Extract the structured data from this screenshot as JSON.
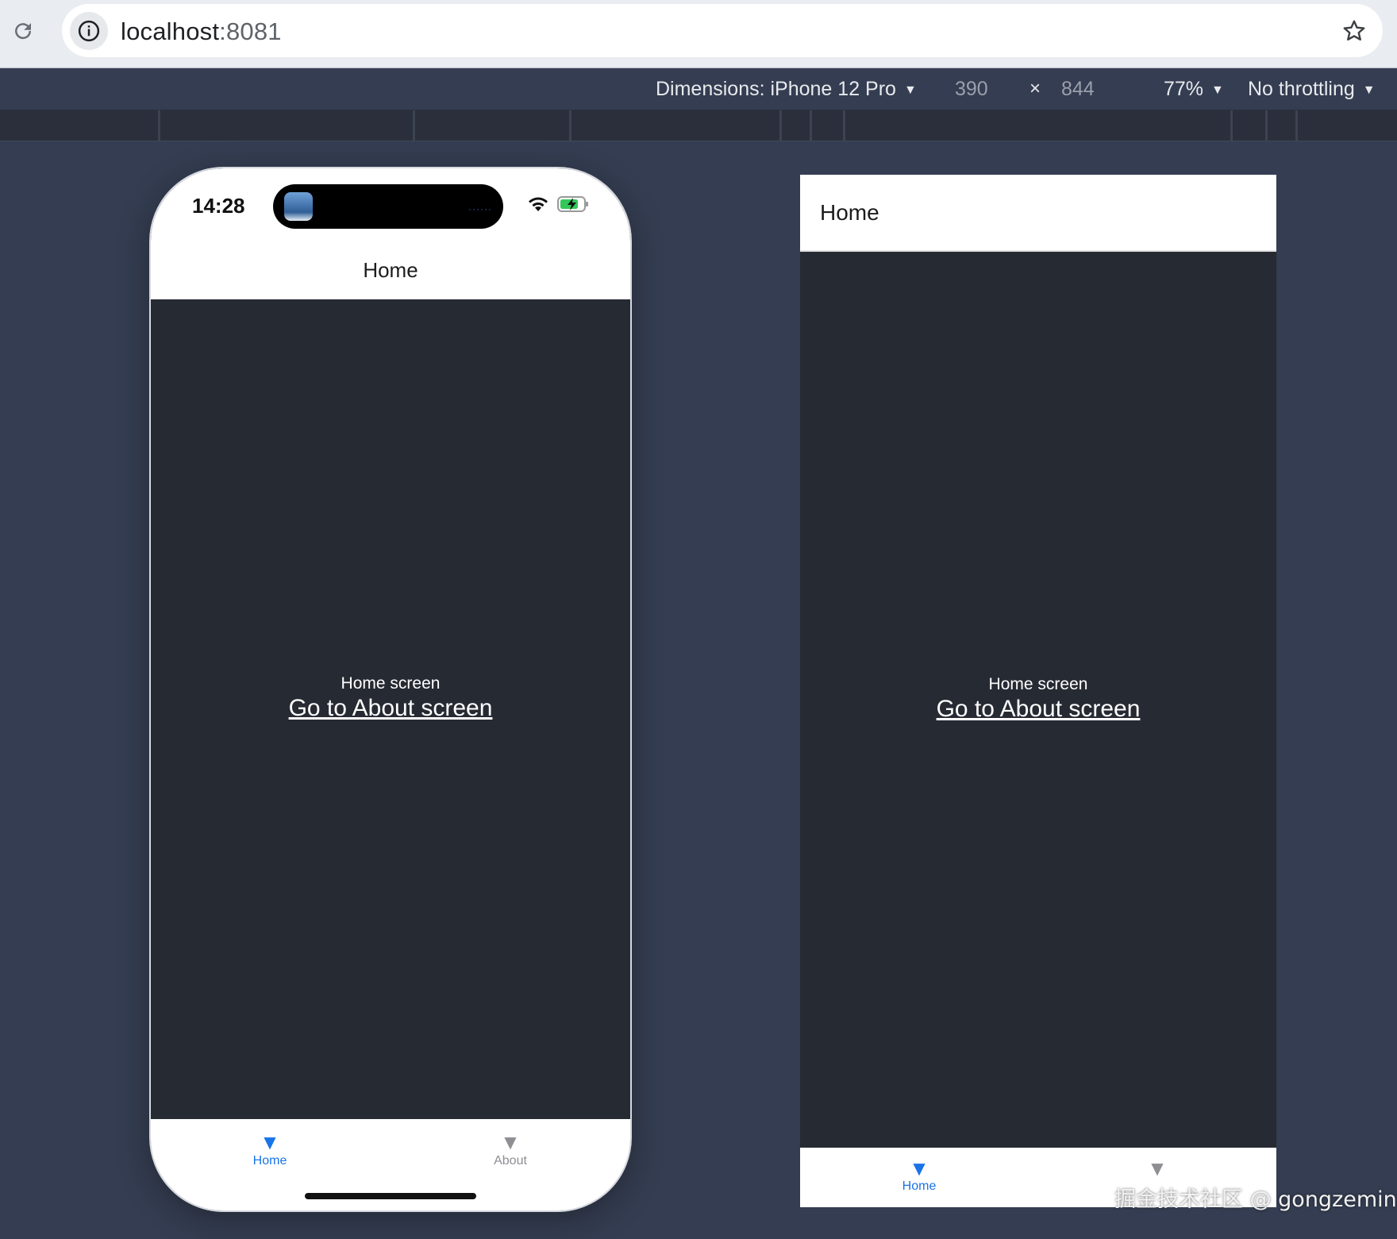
{
  "browser": {
    "url_host": "localhost",
    "url_port": ":8081"
  },
  "device_toolbar": {
    "dimensions_label": "Dimensions: iPhone 12 Pro",
    "width": "390",
    "times": "×",
    "height": "844",
    "zoom": "77%",
    "throttling": "No throttling",
    "caret": "▼"
  },
  "phone": {
    "status_time": "14:28",
    "island_dots": "······",
    "header_title": "Home",
    "screen_label": "Home screen",
    "link_text": "Go to About screen",
    "tabs": [
      {
        "label": "Home",
        "icon": "▼",
        "active": true
      },
      {
        "label": "About",
        "icon": "▼",
        "active": false
      }
    ]
  },
  "web_preview": {
    "header_title": "Home",
    "screen_label": "Home screen",
    "link_text": "Go to About screen",
    "tabs": [
      {
        "label": "Home",
        "icon": "▼",
        "active": true
      },
      {
        "label": "",
        "icon": "▼",
        "active": false
      }
    ]
  },
  "watermark": "掘金技术社区 @ gongzemin",
  "colors": {
    "accent": "#1a73e8",
    "inactive": "#8e8e93",
    "content_bg": "#262a33",
    "devtools_bg": "#343d51"
  }
}
